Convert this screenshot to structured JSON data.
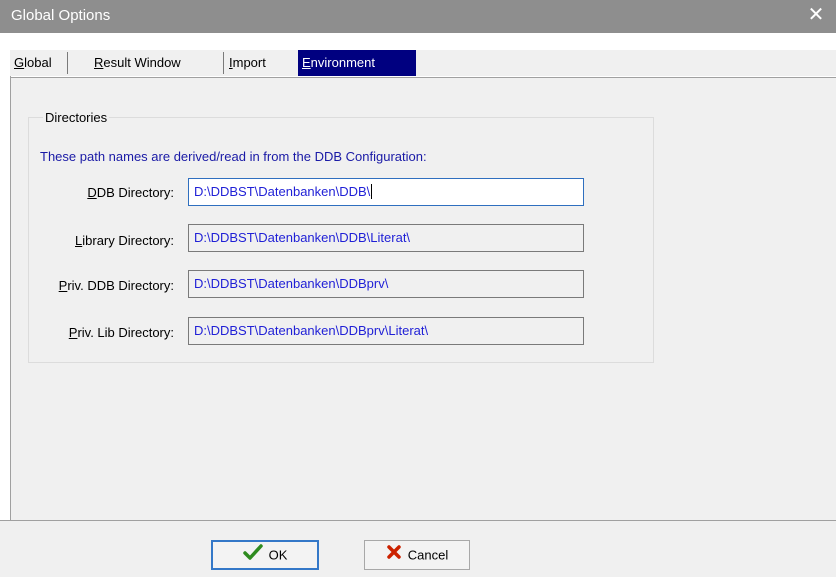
{
  "window": {
    "title": "Global Options",
    "close_icon": "close-icon"
  },
  "tabs": [
    {
      "first": "G",
      "rest": "lobal"
    },
    {
      "first": "R",
      "rest": "esult Window"
    },
    {
      "first": "I",
      "rest": "mport"
    },
    {
      "first": "E",
      "rest": "nvironment",
      "active": true
    }
  ],
  "group": {
    "title": "Directories",
    "info": "These path names are derived/read in from the DDB Configuration:"
  },
  "rows": [
    {
      "label_first": "D",
      "label_rest": "DB Directory:",
      "value": "D:\\DDBST\\Datenbanken\\DDB\\"
    },
    {
      "label_first": "L",
      "label_rest": "ibrary Directory:",
      "value": "D:\\DDBST\\Datenbanken\\DDB\\Literat\\"
    },
    {
      "label_first": "P",
      "label_rest": "riv. DDB Directory:",
      "value": "D:\\DDBST\\Datenbanken\\DDBprv\\"
    },
    {
      "label_first": "P",
      "label_rest": "riv. Lib Directory:",
      "value": "D:\\DDBST\\Datenbanken\\DDBprv\\Literat\\"
    }
  ],
  "buttons": {
    "ok_label": "OK",
    "cancel_label": "Cancel"
  },
  "colors": {
    "accent_tab": "#000080",
    "info_text": "#1a1aa6",
    "path_text": "#1f1fd6",
    "ok_check": "#2e8b1f",
    "cancel_x": "#cc2200"
  }
}
